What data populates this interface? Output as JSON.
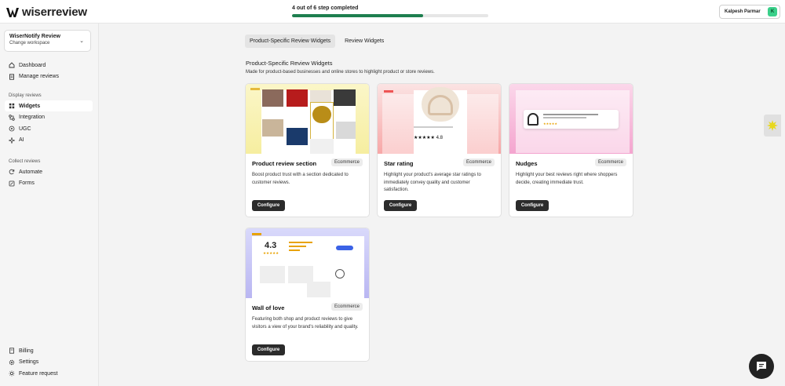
{
  "app": {
    "logo_text": "wiserreview"
  },
  "progress": {
    "label": "4 out of 6 step completed",
    "completed": 4,
    "total": 6,
    "color": "#1e7f4f"
  },
  "user": {
    "name": "Kalpesh Parmar",
    "avatar_letter": "K"
  },
  "workspace": {
    "name": "WiserNotify Review",
    "action": "Change workspace"
  },
  "sidebar": {
    "top_items": [
      {
        "label": "Dashboard",
        "icon": "home-icon"
      },
      {
        "label": "Manage reviews",
        "icon": "document-icon"
      }
    ],
    "display_section": "Display reviews",
    "display_items": [
      {
        "label": "Widgets",
        "icon": "grid-icon",
        "active": true
      },
      {
        "label": "Integration",
        "icon": "integration-icon"
      },
      {
        "label": "UGC",
        "icon": "ugc-icon"
      },
      {
        "label": "AI",
        "icon": "sparkle-icon"
      }
    ],
    "collect_section": "Collect reviews",
    "collect_items": [
      {
        "label": "Automate",
        "icon": "refresh-icon"
      },
      {
        "label": "Forms",
        "icon": "form-icon"
      }
    ],
    "bottom_items": [
      {
        "label": "Billing",
        "icon": "billing-icon"
      },
      {
        "label": "Settings",
        "icon": "gear-icon"
      },
      {
        "label": "Feature request",
        "icon": "bulb-icon"
      }
    ]
  },
  "tabs": [
    {
      "label": "Product-Specific Review Widgets",
      "active": true
    },
    {
      "label": "Review Widgets",
      "active": false
    }
  ],
  "section": {
    "title": "Product-Specific Review Widgets",
    "description": "Made for product-based businesses and online stores to highlight product or store reviews."
  },
  "cards": [
    {
      "title": "Product review section",
      "tag": "Ecommerce",
      "description": "Boost product trust with a section dedicated to customer reviews.",
      "button": "Configure"
    },
    {
      "title": "Star rating",
      "tag": "Ecommerce",
      "description": "Highlight your product's average star ratings to immediately convey quality and customer satisfaction.",
      "button": "Configure",
      "preview_rating": "4.8"
    },
    {
      "title": "Nudges",
      "tag": "Ecommerce",
      "description": "Highlight your best reviews right where shoppers decide, creating immediate trust.",
      "button": "Configure"
    },
    {
      "title": "Wall of love",
      "tag": "Ecommerce",
      "description": "Featuring both shop and product reviews to give visitors a view of your brand's reliability and quality.",
      "button": "Configure",
      "preview_rating": "4.3"
    }
  ],
  "colors": {
    "accent": "#1e7f4f",
    "button_dark": "#2b2b2b",
    "avatar": "#3ad08a"
  }
}
